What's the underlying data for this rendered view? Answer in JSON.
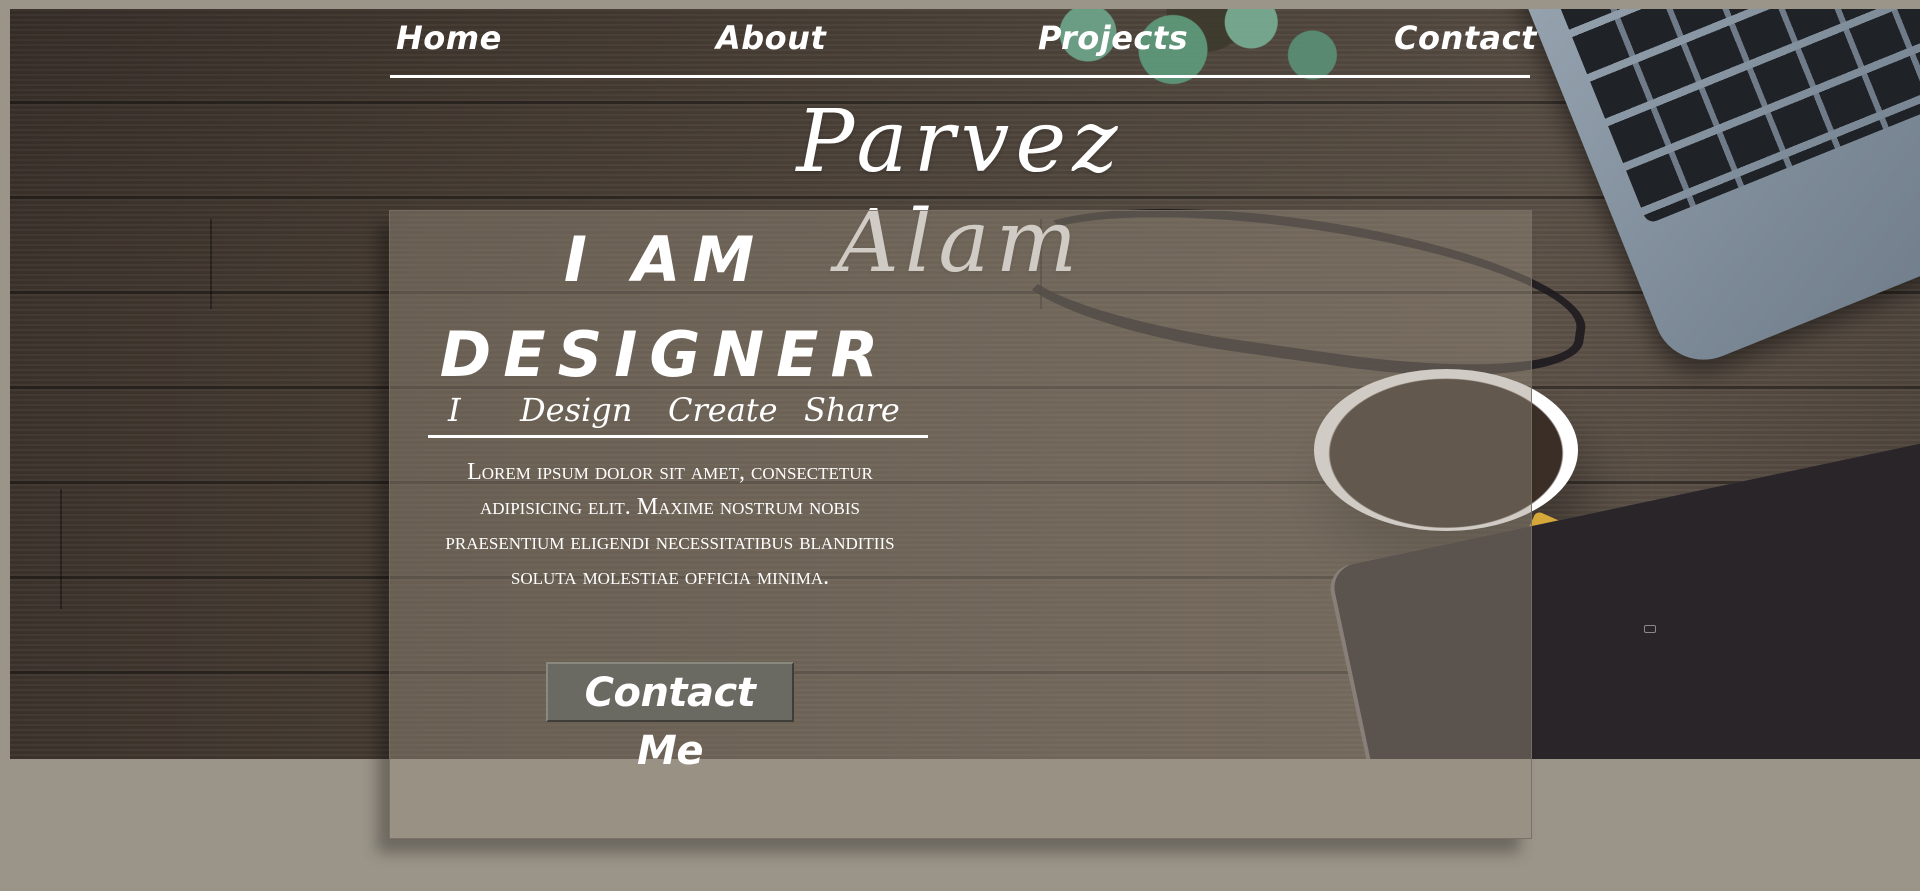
{
  "nav": {
    "links": [
      "Home",
      "About",
      "Projects",
      "Contact"
    ]
  },
  "brand": {
    "name": "Parvez Alam"
  },
  "hero": {
    "headline_line1": "I AM",
    "headline_line2": "DESIGNER",
    "tagline": [
      "I",
      "Design",
      "Create",
      "Share"
    ],
    "bio": "Lorem ipsum dolor sit amet, consectetur adipisicing elit. Maxime nostrum nobis praesentium eligendi necessitatibus blanditiis soluta molestiae officia minima.",
    "cta_label": "Contact Me"
  },
  "colors": {
    "page_background": "#9b9589",
    "card_overlay": "#968c7d",
    "text": "#ffffff",
    "button": "#6b6a62"
  }
}
